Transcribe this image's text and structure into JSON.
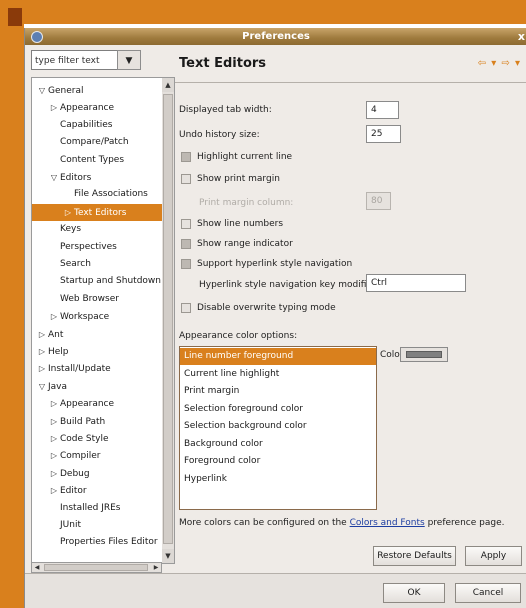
{
  "window": {
    "title": "Preferences",
    "close_glyph": "x"
  },
  "filter": {
    "value": "type filter text",
    "dropdown_glyph": "▼"
  },
  "tree": {
    "items": [
      {
        "label": "General",
        "depth": 0,
        "toggle": "▽"
      },
      {
        "label": "Appearance",
        "depth": 1,
        "toggle": "▷"
      },
      {
        "label": "Capabilities",
        "depth": 1,
        "toggle": ""
      },
      {
        "label": "Compare/Patch",
        "depth": 1,
        "toggle": ""
      },
      {
        "label": "Content Types",
        "depth": 1,
        "toggle": ""
      },
      {
        "label": "Editors",
        "depth": 1,
        "toggle": "▽"
      },
      {
        "label": "File Associations",
        "depth": 2,
        "toggle": ""
      },
      {
        "label": "Text Editors",
        "depth": 2,
        "toggle": "▷",
        "selected": true
      },
      {
        "label": "Keys",
        "depth": 1,
        "toggle": ""
      },
      {
        "label": "Perspectives",
        "depth": 1,
        "toggle": ""
      },
      {
        "label": "Search",
        "depth": 1,
        "toggle": ""
      },
      {
        "label": "Startup and Shutdown",
        "depth": 1,
        "toggle": ""
      },
      {
        "label": "Web Browser",
        "depth": 1,
        "toggle": ""
      },
      {
        "label": "Workspace",
        "depth": 1,
        "toggle": "▷"
      },
      {
        "label": "Ant",
        "depth": 0,
        "toggle": "▷"
      },
      {
        "label": "Help",
        "depth": 0,
        "toggle": "▷"
      },
      {
        "label": "Install/Update",
        "depth": 0,
        "toggle": "▷"
      },
      {
        "label": "Java",
        "depth": 0,
        "toggle": "▽"
      },
      {
        "label": "Appearance",
        "depth": 1,
        "toggle": "▷"
      },
      {
        "label": "Build Path",
        "depth": 1,
        "toggle": "▷"
      },
      {
        "label": "Code Style",
        "depth": 1,
        "toggle": "▷"
      },
      {
        "label": "Compiler",
        "depth": 1,
        "toggle": "▷"
      },
      {
        "label": "Debug",
        "depth": 1,
        "toggle": "▷"
      },
      {
        "label": "Editor",
        "depth": 1,
        "toggle": "▷"
      },
      {
        "label": "Installed JREs",
        "depth": 1,
        "toggle": ""
      },
      {
        "label": "JUnit",
        "depth": 1,
        "toggle": ""
      },
      {
        "label": "Properties Files Editor",
        "depth": 1,
        "toggle": ""
      }
    ]
  },
  "page": {
    "title": "Text Editors",
    "nav_glyphs": "⇦ ▾ ⇨ ▾",
    "tab_width_label": "Displayed tab width:",
    "tab_width_value": "4",
    "undo_label": "Undo history size:",
    "undo_value": "25",
    "checkboxes": [
      {
        "label": "Highlight current line",
        "checked": true,
        "disabled": false
      },
      {
        "label": "Show print margin",
        "checked": false,
        "disabled": false
      }
    ],
    "print_margin_label": "Print margin column:",
    "print_margin_value": "80",
    "checkboxes2": [
      {
        "label": "Show line numbers",
        "checked": false,
        "disabled": false
      },
      {
        "label": "Show range indicator",
        "checked": true,
        "disabled": false
      },
      {
        "label": "Support hyperlink style navigation",
        "checked": true,
        "disabled": false
      }
    ],
    "hyperlink_mod_label": "Hyperlink style navigation key modifier:",
    "hyperlink_mod_value": "Ctrl",
    "overwrite_label": "Disable overwrite typing mode",
    "appearance_label": "Appearance color options:",
    "color_options": [
      "Line number foreground",
      "Current line highlight",
      "Print margin",
      "Selection foreground color",
      "Selection background color",
      "Background color",
      "Foreground color",
      "Hyperlink"
    ],
    "selected_color_option": 0,
    "color_label": "Color:",
    "swatch_color": "#808080",
    "more_colors_prefix": "More colors can be configured on the ",
    "more_colors_link": "Colors and Fonts",
    "more_colors_suffix": " preference page."
  },
  "buttons": {
    "restore_defaults": "Restore Defaults",
    "apply": "Apply",
    "ok": "OK",
    "cancel": "Cancel"
  },
  "colors": {
    "accent": "#d9801d",
    "window_bg": "#efebe7"
  }
}
